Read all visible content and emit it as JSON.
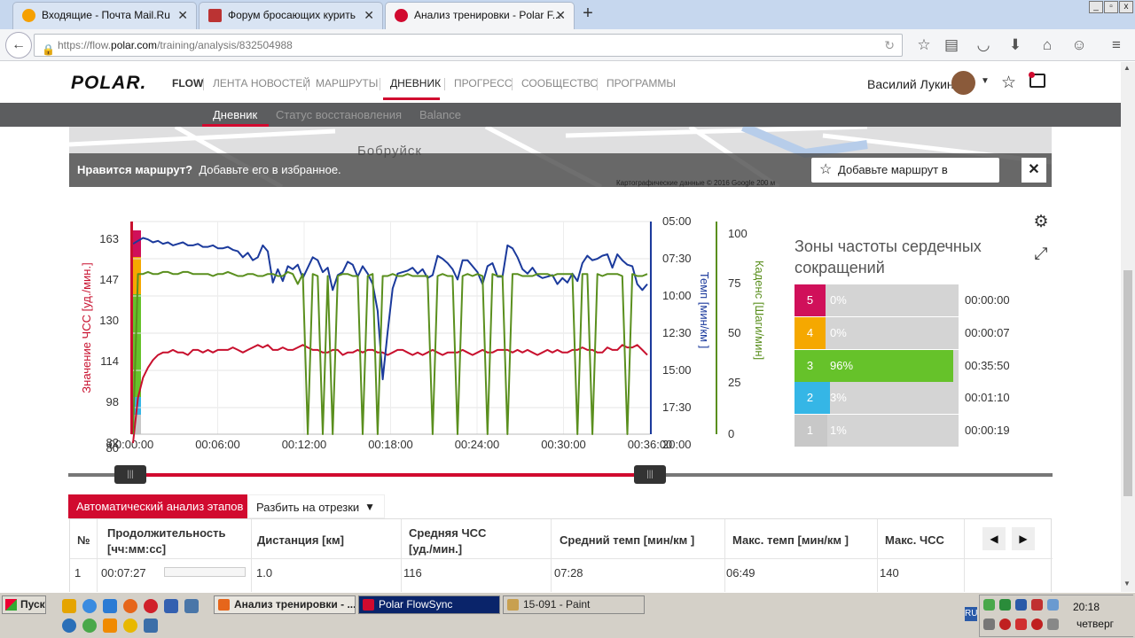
{
  "browser": {
    "tabs": [
      {
        "label": "Входящие - Почта Mail.Ru"
      },
      {
        "label": "Форум бросающих курить"
      },
      {
        "label": "Анализ тренировки - Polar F..."
      }
    ],
    "url_prefix": "https://flow.",
    "url_domain": "polar.com",
    "url_path": "/training/analysis/832504988"
  },
  "site": {
    "logo": "POLAR.",
    "flow_label": "FLOW",
    "nav": [
      "ЛЕНТА НОВОСТЕЙ",
      "МАРШРУТЫ",
      "ДНЕВНИК",
      "ПРОГРЕСС",
      "СООБЩЕСТВО",
      "ПРОГРАММЫ"
    ],
    "user_name": "Василий Лукин",
    "subnav": [
      "Дневник",
      "Статус восстановления",
      "Balance"
    ]
  },
  "map": {
    "city": "Бобруйск",
    "prompt_bold": "Нравится маршрут?",
    "prompt": "Добавьте его в избранное.",
    "fav_button": "Добавьте маршрут в избранное",
    "copyright": "Картографические данные © 2016 Google     200 м"
  },
  "chart_data": {
    "type": "line",
    "x_ticks": [
      "00:00:00",
      "00:06:00",
      "00:12:00",
      "00:18:00",
      "00:24:00",
      "00:30:00",
      "00:36:00"
    ],
    "axes": {
      "hr": {
        "label": "Значение ЧСС [уд./мин.]",
        "ticks": [
          "163",
          "147",
          "130",
          "114",
          "98",
          "82",
          "80"
        ],
        "color": "#c8102e"
      },
      "pace": {
        "label": "Темп [мин/км ]",
        "ticks": [
          "05:00",
          "07:30",
          "10:00",
          "12:30",
          "15:00",
          "17:30",
          "20:00"
        ],
        "color": "#1b3a9c"
      },
      "cadence": {
        "label": "Каденс [Шаги/мин]",
        "ticks": [
          "100",
          "75",
          "50",
          "25",
          "0"
        ],
        "color": "#5a8f1e"
      }
    },
    "series": [
      {
        "axis": "hr",
        "color": "#c8102e",
        "values": [
          82,
          100,
          108,
          112,
          115,
          117,
          118,
          118,
          119,
          118,
          118,
          117,
          119,
          119,
          118,
          119,
          118,
          119,
          119,
          119,
          120,
          119,
          118,
          119,
          120,
          121,
          120,
          121,
          119,
          119,
          120,
          119,
          119,
          120,
          121,
          120,
          119,
          119,
          118,
          118,
          119,
          119,
          117,
          118,
          118,
          119,
          118,
          119,
          119,
          118,
          118,
          117,
          118,
          119,
          119,
          118,
          117,
          118,
          117,
          118,
          119,
          118,
          117,
          118,
          118,
          118,
          119,
          118,
          117,
          118,
          119,
          118,
          118,
          119,
          119,
          119,
          118,
          119,
          118,
          119,
          118,
          117,
          118,
          119,
          118,
          119,
          118,
          118,
          119,
          119,
          120,
          119,
          119,
          118,
          118,
          120,
          119,
          119,
          121,
          120,
          120,
          121,
          119,
          117
        ]
      },
      {
        "axis": "pace",
        "color": "#1b3a9c",
        "values": [
          6.5,
          6.3,
          6.1,
          6.2,
          6.4,
          6.3,
          6.5,
          6.4,
          6.6,
          6.5,
          6.4,
          6.6,
          6.6,
          6.5,
          6.7,
          6.7,
          6.6,
          6.8,
          6.8,
          6.7,
          6.9,
          7.0,
          7.4,
          7.1,
          7.6,
          7.4,
          6.6,
          7.0,
          9.1,
          8.2,
          9.0,
          8.0,
          8.2,
          7.9,
          8.8,
          8.1,
          7.4,
          7.6,
          8.4,
          8.1,
          9.6,
          8.6,
          8.4,
          7.7,
          7.9,
          8.7,
          8.0,
          8.5,
          9.2,
          11.0,
          15.6,
          12.4,
          9.5,
          8.5,
          8.4,
          8.3,
          8.1,
          8.5,
          8.2,
          8.8,
          8.6,
          7.3,
          7.5,
          7.8,
          8.2,
          8.9,
          7.6,
          7.6,
          8.0,
          8.4,
          9.2,
          8.0,
          7.8,
          8.7,
          8.7,
          6.6,
          6.8,
          7.4,
          8.2,
          8.5,
          8.1,
          8.6,
          8.8,
          8.7,
          8.6,
          9.2,
          8.8,
          9.1,
          8.5,
          9.0,
          7.8,
          7.3,
          7.6,
          7.5,
          7.3,
          7.2,
          8.1,
          7.2,
          7.6,
          7.9,
          8.0,
          9.2,
          9.6,
          9.2
        ]
      },
      {
        "axis": "cadence",
        "color": "#5a8f1e",
        "values": [
          0,
          80,
          80,
          81,
          80,
          80,
          81,
          81,
          80,
          80,
          81,
          81,
          80,
          80,
          80,
          80,
          79,
          80,
          80,
          81,
          80,
          79,
          79,
          80,
          80,
          79,
          79,
          80,
          80,
          79,
          79,
          81,
          80,
          75,
          80,
          0,
          80,
          79,
          0,
          79,
          0,
          79,
          80,
          80,
          79,
          79,
          0,
          79,
          80,
          0,
          79,
          79,
          80,
          79,
          79,
          80,
          79,
          79,
          79,
          79,
          0,
          79,
          80,
          79,
          79,
          0,
          79,
          80,
          79,
          80,
          79,
          0,
          80,
          79,
          79,
          0,
          80,
          80,
          79,
          79,
          79,
          80,
          80,
          80,
          79,
          80,
          80,
          80,
          80,
          0,
          80,
          80,
          0,
          80,
          79,
          80,
          80,
          80,
          79,
          0,
          80,
          79,
          79,
          80
        ]
      }
    ]
  },
  "zones": {
    "title": "Зоны частоты сердечных сокращений",
    "rows": [
      {
        "num": "5",
        "pct": "0%",
        "fraction": 0.0,
        "time": "00:00:00",
        "color": "#d0105a"
      },
      {
        "num": "4",
        "pct": "0%",
        "fraction": 0.0,
        "time": "00:00:07",
        "color": "#f5a800"
      },
      {
        "num": "3",
        "pct": "96%",
        "fraction": 0.96,
        "time": "00:35:50",
        "color": "#66c22a"
      },
      {
        "num": "2",
        "pct": "3%",
        "fraction": 0.03,
        "time": "00:01:10",
        "color": "#35b6e6"
      },
      {
        "num": "1",
        "pct": "1%",
        "fraction": 0.01,
        "time": "00:00:19",
        "color": "#c8c8c8"
      }
    ]
  },
  "table": {
    "auto_button": "Автоматический анализ этапов",
    "split_button": "Разбить на отрезки",
    "headers": [
      "№",
      "Продолжительность\n[чч:мм:сс]",
      "Дистанция [км]",
      "Средняя ЧСС\n[уд./мин.]",
      "Средний темп [мин/км ]",
      "Макс. темп [мин/км ]",
      "Макс. ЧСС"
    ],
    "row": [
      "1",
      "00:07:27",
      "1.0",
      "116",
      "07:28",
      "06:49",
      "140"
    ]
  },
  "taskbar": {
    "start": "Пуск",
    "items": [
      "Анализ тренировки - ...",
      "Polar FlowSync",
      "15-091 - Paint"
    ],
    "lang": "RU",
    "time": "20:18",
    "day": "четверг"
  }
}
